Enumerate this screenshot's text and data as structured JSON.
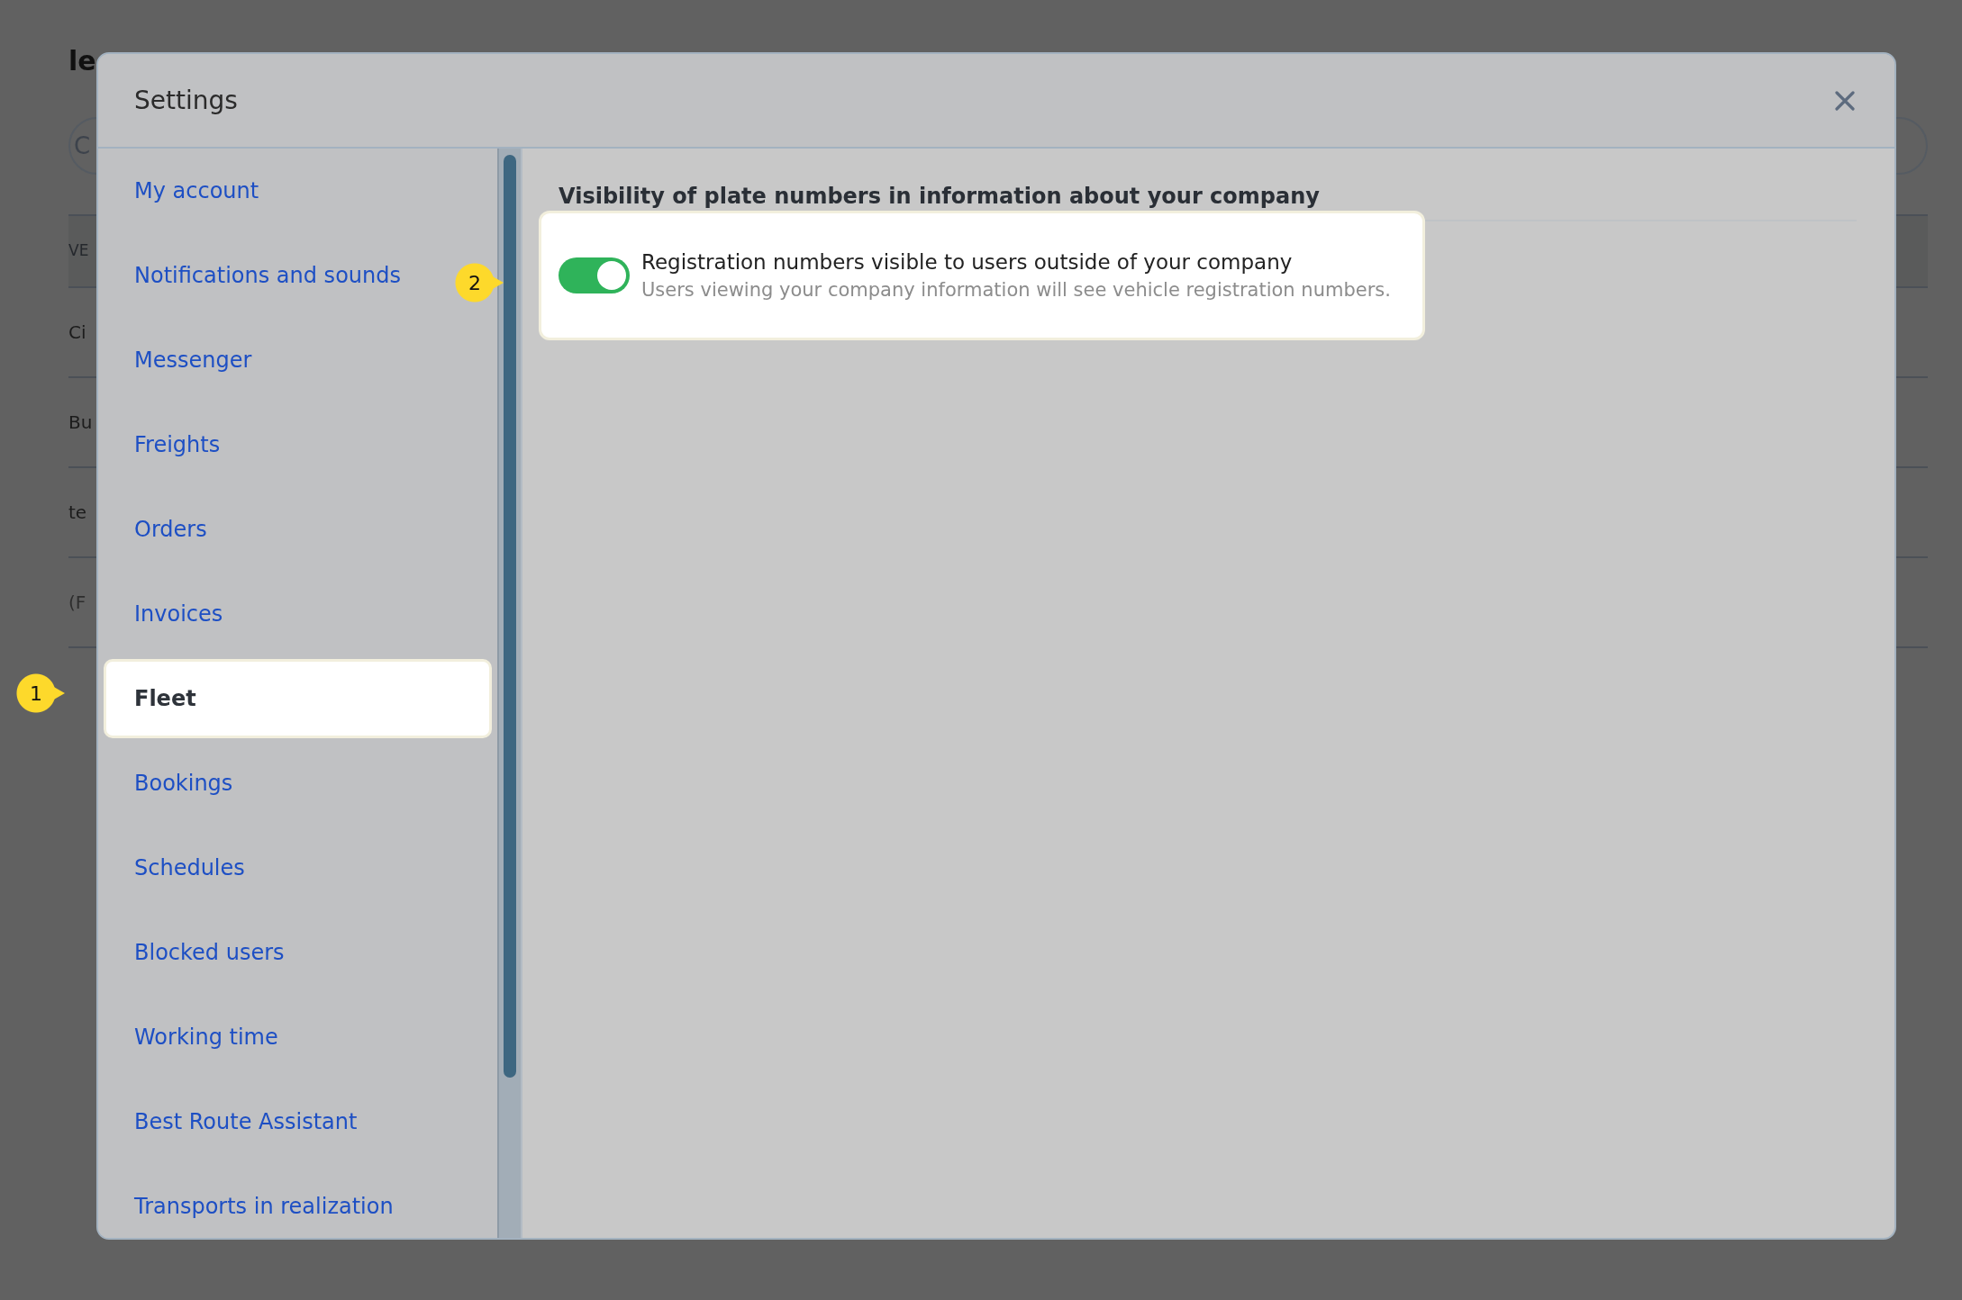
{
  "background": {
    "heading": "le",
    "search_text": "C",
    "table": {
      "header": "VE",
      "rows": [
        "Ci",
        "Bu",
        "te",
        "(F"
      ]
    }
  },
  "modal": {
    "title": "Settings",
    "sidebar": {
      "items": [
        {
          "label": "My account",
          "selected": false
        },
        {
          "label": "Notifications and sounds",
          "selected": false
        },
        {
          "label": "Messenger",
          "selected": false
        },
        {
          "label": "Freights",
          "selected": false
        },
        {
          "label": "Orders",
          "selected": false
        },
        {
          "label": "Invoices",
          "selected": false
        },
        {
          "label": "Fleet",
          "selected": true
        },
        {
          "label": "Bookings",
          "selected": false
        },
        {
          "label": "Schedules",
          "selected": false
        },
        {
          "label": "Blocked users",
          "selected": false
        },
        {
          "label": "Working time",
          "selected": false
        },
        {
          "label": "Best Route Assistant",
          "selected": false
        },
        {
          "label": "Transports in realization",
          "selected": false
        }
      ]
    },
    "section": {
      "title": "Visibility of plate numbers in information about your company",
      "setting": {
        "label": "Registration numbers visible to users outside of your company",
        "description": "Users viewing your company information will see vehicle registration numbers.",
        "on": true
      }
    }
  },
  "callouts": [
    {
      "label": "1"
    },
    {
      "label": "2"
    }
  ]
}
